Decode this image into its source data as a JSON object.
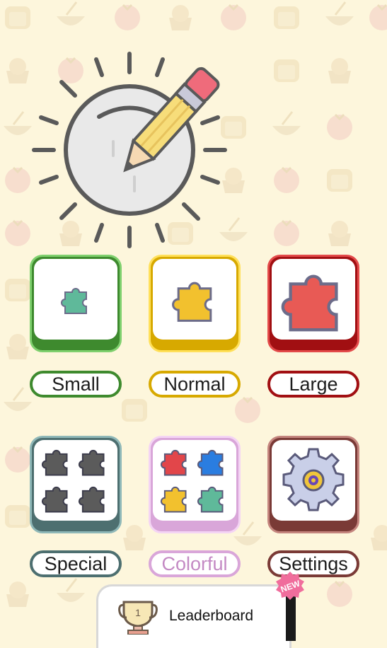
{
  "menu": {
    "tiles": [
      {
        "label": "Small",
        "icon": "small-puzzle-icon"
      },
      {
        "label": "Normal",
        "icon": "normal-puzzle-icon"
      },
      {
        "label": "Large",
        "icon": "large-puzzle-icon"
      },
      {
        "label": "Special",
        "icon": "special-puzzles-icon"
      },
      {
        "label": "Colorful",
        "icon": "colorful-puzzles-icon"
      },
      {
        "label": "Settings",
        "icon": "gear-icon"
      }
    ]
  },
  "leaderboard": {
    "label": "Leaderboard",
    "trophy_rank": "1",
    "badge": "NEW"
  },
  "colors": {
    "background": "#fdf6dc",
    "small": "#3e8a2e",
    "normal": "#d7a900",
    "large": "#a10f12",
    "special": "#4d6f70",
    "colorful": "#d9a6d9",
    "settings": "#7a3a36"
  }
}
